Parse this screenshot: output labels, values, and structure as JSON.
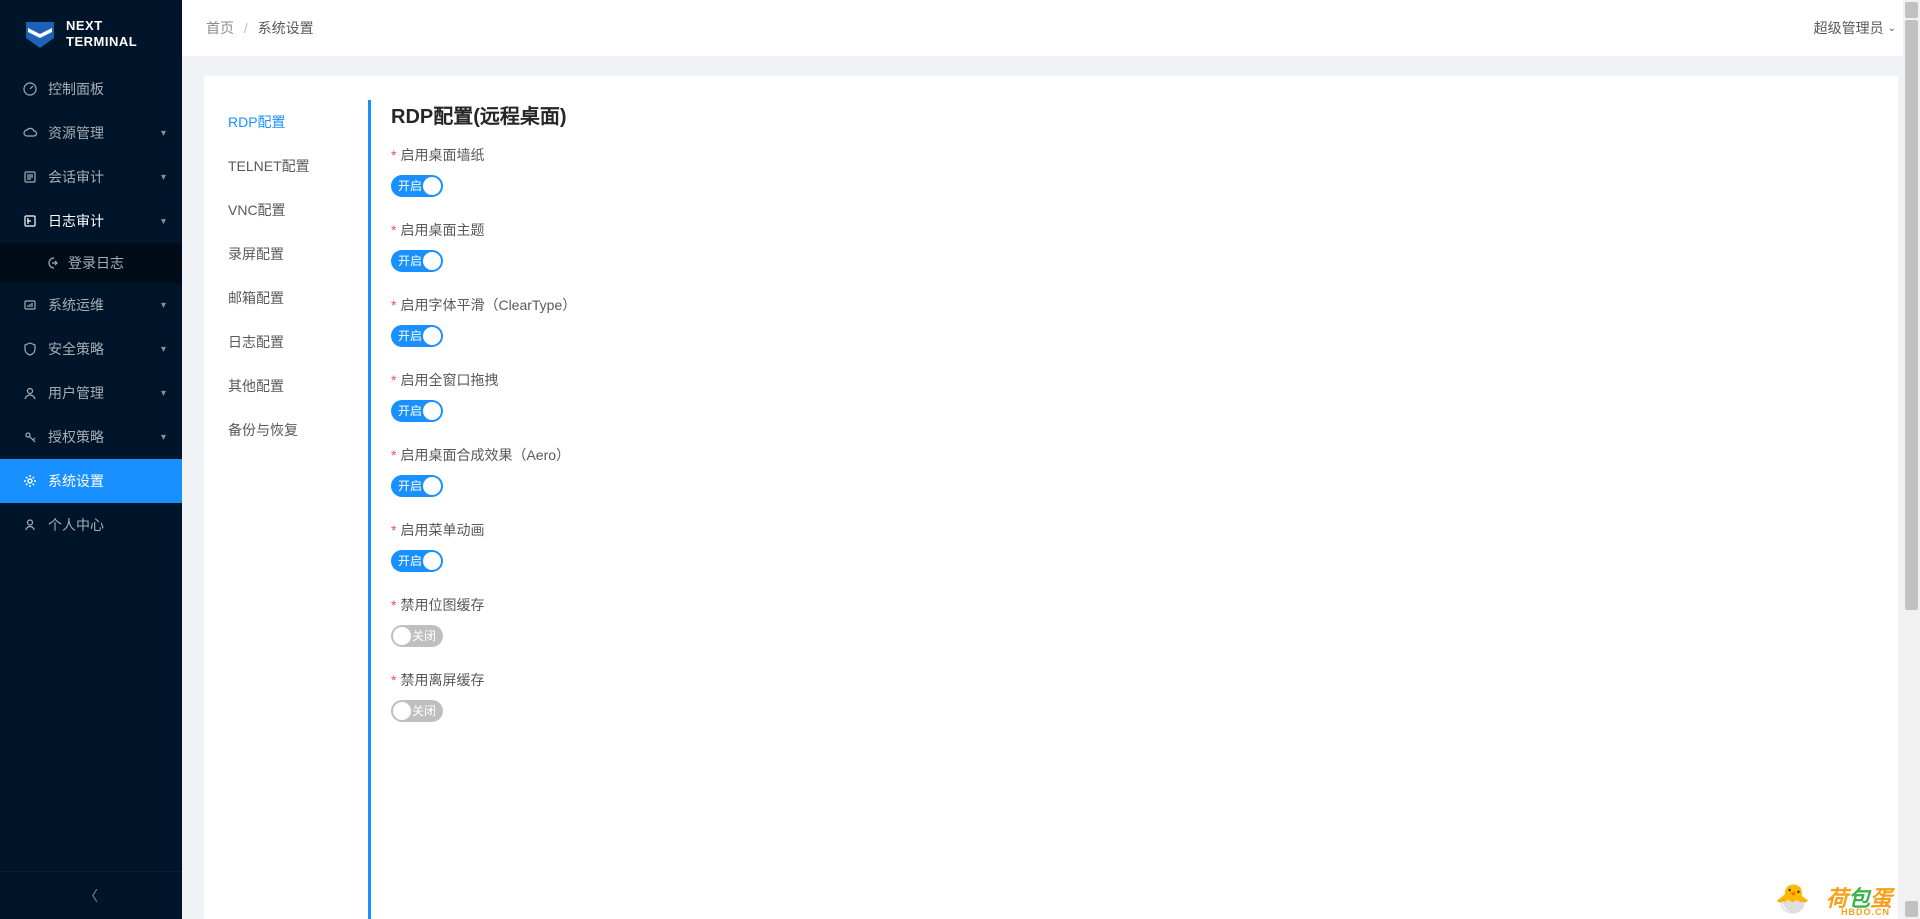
{
  "app": {
    "name_line1": "NEXT",
    "name_line2": "TERMINAL"
  },
  "breadcrumb": {
    "home": "首页",
    "current": "系统设置",
    "sep": "/"
  },
  "user": {
    "name": "超级管理员"
  },
  "sidebar": {
    "items": [
      {
        "label": "控制面板"
      },
      {
        "label": "资源管理"
      },
      {
        "label": "会话审计"
      },
      {
        "label": "日志审计"
      },
      {
        "label": "系统运维"
      },
      {
        "label": "安全策略"
      },
      {
        "label": "用户管理"
      },
      {
        "label": "授权策略"
      },
      {
        "label": "系统设置"
      },
      {
        "label": "个人中心"
      }
    ],
    "submenu_login_log": "登录日志"
  },
  "tabs": [
    {
      "label": "RDP配置"
    },
    {
      "label": "TELNET配置"
    },
    {
      "label": "VNC配置"
    },
    {
      "label": "录屏配置"
    },
    {
      "label": "邮箱配置"
    },
    {
      "label": "日志配置"
    },
    {
      "label": "其他配置"
    },
    {
      "label": "备份与恢复"
    }
  ],
  "form": {
    "title": "RDP配置(远程桌面)",
    "on_text": "开启",
    "off_text": "关闭",
    "items": [
      {
        "label": "启用桌面墙纸",
        "value": true
      },
      {
        "label": "启用桌面主题",
        "value": true
      },
      {
        "label": "启用字体平滑（ClearType）",
        "value": true
      },
      {
        "label": "启用全窗口拖拽",
        "value": true
      },
      {
        "label": "启用桌面合成效果（Aero）",
        "value": true
      },
      {
        "label": "启用菜单动画",
        "value": true
      },
      {
        "label": "禁用位图缓存",
        "value": false
      },
      {
        "label": "禁用离屏缓存",
        "value": false
      }
    ]
  },
  "watermark": {
    "a": "荷",
    "b": "包",
    "c": "蛋",
    "sub": "HBDO.CN"
  }
}
